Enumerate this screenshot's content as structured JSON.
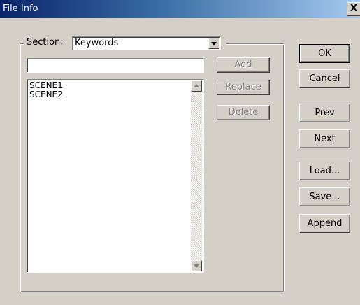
{
  "window": {
    "title": "File Info",
    "close_label": "X"
  },
  "section": {
    "label": "Section:",
    "selected": "Keywords"
  },
  "keyword_input": {
    "value": ""
  },
  "keywords": [
    "SCENE1",
    "SCENE2"
  ],
  "list_buttons": {
    "add": "Add",
    "replace": "Replace",
    "delete": "Delete"
  },
  "dialog_buttons": {
    "ok": "OK",
    "cancel": "Cancel",
    "prev": "Prev",
    "next": "Next",
    "load": "Load...",
    "save": "Save...",
    "append": "Append"
  }
}
